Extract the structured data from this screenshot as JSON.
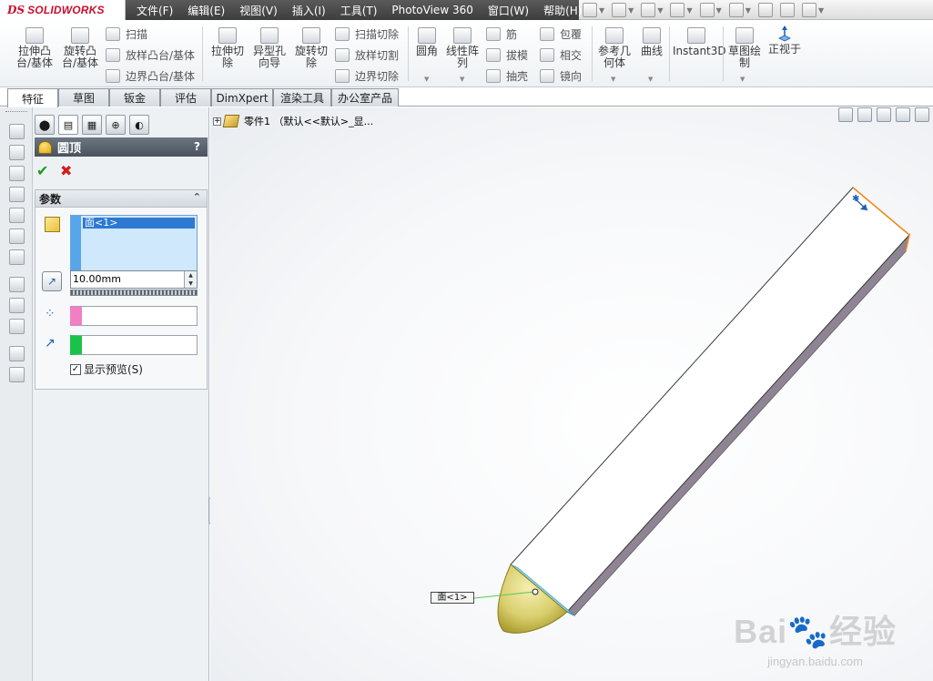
{
  "app": {
    "logo_prefix": "DS",
    "logo_text": "SOLIDWORKS"
  },
  "menu": [
    "文件(F)",
    "编辑(E)",
    "视图(V)",
    "插入(I)",
    "工具(T)",
    "PhotoView 360",
    "窗口(W)",
    "帮助(H)"
  ],
  "commands": {
    "extrude_boss": "拉伸凸台/基体",
    "revolve_boss": "旋转凸台/基体",
    "sweep": "扫描",
    "loft_boss": "放样凸台/基体",
    "boundary_boss": "边界凸台/基体",
    "extrude_cut": "拉伸切除",
    "hole_wizard": "异型孔向导",
    "revolve_cut": "旋转切除",
    "sweep_cut": "扫描切除",
    "loft_cut": "放样切割",
    "boundary_cut": "边界切除",
    "fillet": "圆角",
    "linear_pattern": "线性阵列",
    "rib": "筋",
    "draft": "拔模",
    "shell": "抽壳",
    "wrap": "包覆",
    "intersect": "相交",
    "mirror": "镜向",
    "ref_geometry": "参考几何体",
    "curves": "曲线",
    "instant3d": "Instant3D",
    "sketch": "草图绘制",
    "normal_to": "正视于"
  },
  "tabs": [
    "特征",
    "草图",
    "钣金",
    "评估",
    "DimXpert",
    "渲染工具",
    "办公室产品"
  ],
  "property_manager": {
    "title": "圆顶",
    "help": "?",
    "params_header": "参数",
    "selected_face": "面<1>",
    "distance": "10.00mm",
    "show_preview": "显示预览(S)",
    "show_preview_checked": true
  },
  "tree": {
    "root": "零件1 （默认<<默认>_显..."
  },
  "callout": "面<1>",
  "watermark": {
    "logo": "Bai🐾经验",
    "sub": "jingyan.baidu.com"
  },
  "colors": {
    "accent": "#2d79d3",
    "menubar": "#3d3d3d",
    "logo_red": "#c8102e",
    "face_highlight": "#a3d9f0"
  }
}
